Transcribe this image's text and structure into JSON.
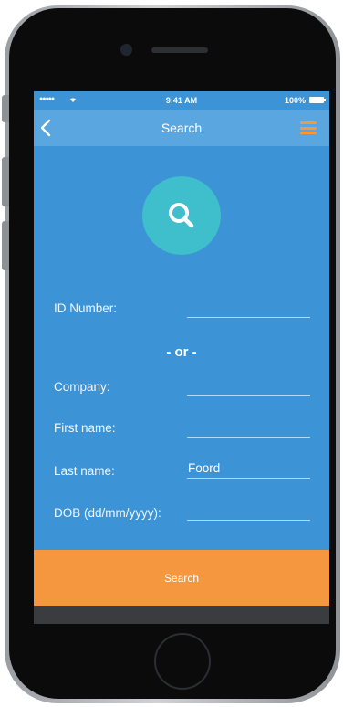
{
  "status_bar": {
    "signal": "●●●●●",
    "time": "9:41 AM",
    "battery": "100%",
    "wifi_icon": "wifi-icon",
    "battery_icon": "battery-icon"
  },
  "nav": {
    "title": "Search",
    "back_icon": "chevron-left-icon",
    "menu_icon": "hamburger-menu-icon"
  },
  "hero_icon": "search-icon",
  "form": {
    "id_number": {
      "label": "ID Number:",
      "value": ""
    },
    "or_label": "- or -",
    "company": {
      "label": "Company:",
      "value": ""
    },
    "first_name": {
      "label": "First name:",
      "value": ""
    },
    "last_name": {
      "label": "Last name:",
      "value": "Foord"
    },
    "dob": {
      "label": "DOB (dd/mm/yyyy):",
      "value": ""
    }
  },
  "search_button": "Search",
  "colors": {
    "background": "#3c93d6",
    "nav_bar": "#5aa6e0",
    "accent": "#f4973f",
    "search_circle": "#3fbecb"
  }
}
